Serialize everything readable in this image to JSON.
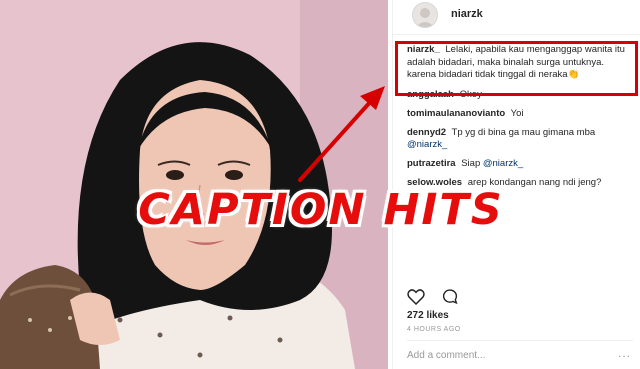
{
  "post": {
    "username": "niarzk",
    "caption": {
      "user": "niarzk_",
      "text": "Lelaki, apabila kau menganggap wanita itu adalah bidadari, maka binalah surga untuknya. karena bidadari tidak tinggal di neraka👏"
    },
    "comments": [
      {
        "user": "anggalaah",
        "text": "Okey"
      },
      {
        "user": "tomimaulananovianto",
        "text": "Yoi"
      },
      {
        "user": "dennyd2",
        "text": "Tp yg di bina ga mau gimana mba",
        "mention": "@niarzk_"
      },
      {
        "user": "putrazetira",
        "text": "Siap",
        "mention": "@niarzk_"
      },
      {
        "user": "selow.woles",
        "text": "arep kondangan nang ndi jeng?"
      }
    ],
    "likes": "272 likes",
    "time": "4 HOURS AGO",
    "add_comment_placeholder": "Add a comment...",
    "more_label": "..."
  },
  "overlay": {
    "title": "CAPTION HITS"
  },
  "colors": {
    "highlight": "#d60000",
    "overlay_text": "#e60d0d",
    "mention": "#003569"
  },
  "icons": [
    "heart-icon",
    "comment-icon",
    "more-options-icon"
  ]
}
